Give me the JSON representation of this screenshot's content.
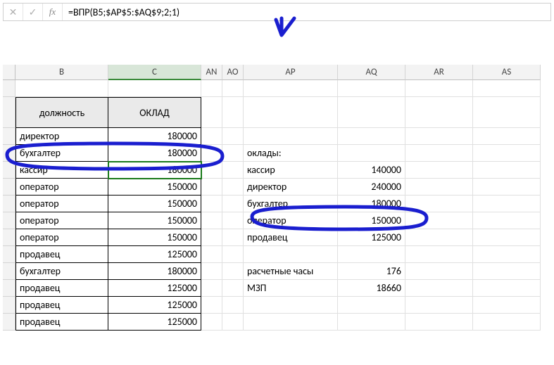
{
  "formula_bar": {
    "cancel": "✕",
    "confirm": "✓",
    "fx": "fx",
    "formula": "=ВПР(B5;$AP$5:$AQ$9;2;1)"
  },
  "columns": [
    "B",
    "C",
    "AN",
    "AO",
    "AP",
    "AQ",
    "AR",
    "AS"
  ],
  "left_table": {
    "header_position": "должность",
    "header_salary": "ОКЛАД",
    "rows": [
      {
        "pos": "директор",
        "sal": "180000"
      },
      {
        "pos": "бухгалтер",
        "sal": "180000"
      },
      {
        "pos": "кассир",
        "sal": "180000"
      },
      {
        "pos": "оператор",
        "sal": "150000"
      },
      {
        "pos": "оператор",
        "sal": "150000"
      },
      {
        "pos": "оператор",
        "sal": "150000"
      },
      {
        "pos": "оператор",
        "sal": "150000"
      },
      {
        "pos": "продавец",
        "sal": "125000"
      },
      {
        "pos": "бухгалтер",
        "sal": "180000"
      },
      {
        "pos": "продавец",
        "sal": "125000"
      },
      {
        "pos": "продавец",
        "sal": "125000"
      },
      {
        "pos": "продавец",
        "sal": "125000"
      }
    ]
  },
  "right_block": {
    "title": "оклады:",
    "rows": [
      {
        "pos": "кассир",
        "sal": "140000"
      },
      {
        "pos": "директор",
        "sal": "240000"
      },
      {
        "pos": "бухгалтер",
        "sal": "180000"
      },
      {
        "pos": "оператор",
        "sal": "150000"
      },
      {
        "pos": "продавец",
        "sal": "125000"
      }
    ],
    "hours_label": "расчетные часы",
    "hours_value": "176",
    "mzp_label": "МЗП",
    "mzp_value": "18660"
  },
  "annotation": {
    "stroke": "#1a1ecf"
  }
}
